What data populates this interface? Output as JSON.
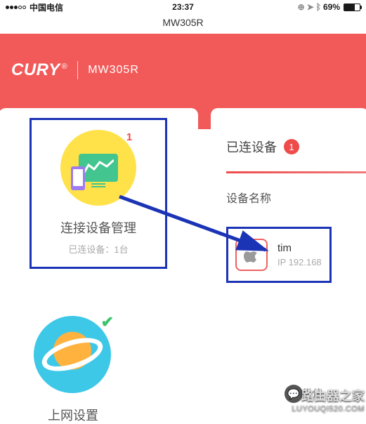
{
  "status": {
    "carrier": "中国电信",
    "time": "23:37",
    "battery_pct": "69%",
    "nav_title": "MW305R"
  },
  "hero": {
    "brand": "CURY",
    "model": "MW305R"
  },
  "device_tile": {
    "badge": "1",
    "title": "连接设备管理",
    "subtitle": "已连设备：1台"
  },
  "network_tile": {
    "title": "上网设置"
  },
  "right_panel": {
    "header": "已连设备",
    "count": "1",
    "col_header": "设备名称",
    "device": {
      "name": "tim",
      "ip": "IP 192.168"
    }
  },
  "watermark": {
    "cn": "路由器之家",
    "en": "LUYOUQI520.COM",
    "wx": "微信"
  }
}
